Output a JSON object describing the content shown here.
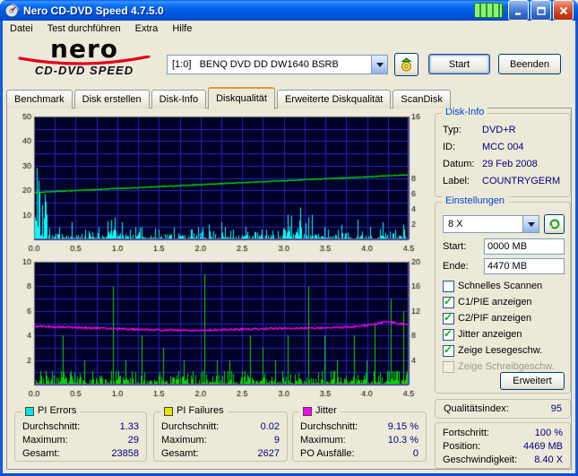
{
  "window": {
    "title": "Nero CD-DVD Speed 4.7.5.0"
  },
  "menu": {
    "items": [
      "Datei",
      "Test durchführen",
      "Extra",
      "Hilfe"
    ]
  },
  "logo": {
    "brand": "nero",
    "product": "CD-DVD SPEED"
  },
  "toolbar": {
    "drive": "[1:0]   BENQ DVD DD DW1640 BSRB",
    "start_label": "Start",
    "quit_label": "Beenden"
  },
  "tabs": {
    "active_index": 3,
    "items": [
      {
        "label": "Benchmark"
      },
      {
        "label": "Disk erstellen"
      },
      {
        "label": "Disk-Info"
      },
      {
        "label": "Diskqualität"
      },
      {
        "label": "Erweiterte Diskqualität"
      },
      {
        "label": "ScanDisk"
      }
    ]
  },
  "disk_info": {
    "title": "Disk-Info",
    "rows": [
      {
        "label": "Typ:",
        "value": "DVD+R"
      },
      {
        "label": "ID:",
        "value": "MCC 004"
      },
      {
        "label": "Datum:",
        "value": "29 Feb 2008"
      },
      {
        "label": "Label:",
        "value": "COUNTRYGERM"
      }
    ]
  },
  "settings": {
    "title": "Einstellungen",
    "speed_value": "8 X",
    "start_label": "Start:",
    "start_value": "0000 MB",
    "end_label": "Ende:",
    "end_value": "4470 MB",
    "advanced_label": "Erweitert",
    "checkboxes": [
      {
        "label": "Schnelles Scannen",
        "checked": false,
        "enabled": true
      },
      {
        "label": "C1/PIE anzeigen",
        "checked": true,
        "enabled": true
      },
      {
        "label": "C2/PIF anzeigen",
        "checked": true,
        "enabled": true
      },
      {
        "label": "Jitter anzeigen",
        "checked": true,
        "enabled": true
      },
      {
        "label": "Zeige Lesegeschw.",
        "checked": true,
        "enabled": true
      },
      {
        "label": "Zeige Schreibgeschw.",
        "checked": false,
        "enabled": false
      }
    ]
  },
  "quality": {
    "label": "Qualitätsindex:",
    "value": "95"
  },
  "progress": {
    "rows": [
      {
        "label": "Fortschritt:",
        "value": "100 %"
      },
      {
        "label": "Position:",
        "value": "4469 MB"
      },
      {
        "label": "Geschwindigkeit:",
        "value": "8.40 X"
      }
    ]
  },
  "stats": [
    {
      "title": "PI Errors",
      "color": "#00E6E6",
      "rows": [
        {
          "label": "Durchschnitt:",
          "value": "1.33"
        },
        {
          "label": "Maximum:",
          "value": "29"
        },
        {
          "label": "Gesamt:",
          "value": "23858"
        }
      ]
    },
    {
      "title": "PI Failures",
      "color": "#E6E600",
      "rows": [
        {
          "label": "Durchschnitt:",
          "value": "0.02"
        },
        {
          "label": "Maximum:",
          "value": "9"
        },
        {
          "label": "Gesamt:",
          "value": "2627"
        }
      ]
    },
    {
      "title": "Jitter",
      "color": "#FF00FF",
      "rows": [
        {
          "label": "Durchschnitt:",
          "value": "9.15 %"
        },
        {
          "label": "Maximum:",
          "value": "10.3 %"
        },
        {
          "label": "PO Ausfälle:",
          "value": "0"
        }
      ]
    }
  ],
  "icons": {
    "app-icon": "cd-speedometer",
    "power-indicator-icon": "green-battery",
    "minimize-icon": "underscore",
    "maximize-icon": "square",
    "close-icon": "x",
    "eject-disc-icon": "disc-with-up-arrow",
    "dropdown-arrow-icon": "black-triangle-down",
    "refresh-icon": "green-circular-arrow"
  },
  "chart_data": [
    {
      "type": "spikes+line",
      "x_range": [
        0,
        4.5
      ],
      "x_ticks": [
        "0.0",
        "0.5",
        "1.0",
        "1.5",
        "2.0",
        "2.5",
        "3.0",
        "3.5",
        "4.0",
        "4.5"
      ],
      "left_axis": {
        "name": "PI Errors",
        "range": [
          0,
          50
        ],
        "ticks": [
          10,
          20,
          30,
          40,
          50
        ]
      },
      "right_axis": {
        "name": "Lesegeschwindigkeit",
        "range": [
          0,
          16
        ],
        "ticks": [
          2,
          4,
          6,
          8,
          16
        ]
      },
      "bg": "#000028",
      "grid": {
        "color": "#2626B8",
        "x_step": 0.25,
        "y_step": 5
      },
      "series": [
        {
          "name": "PI Errors",
          "type": "spikes",
          "axis": "left",
          "color": "#00FFFF",
          "baseline": {
            "avg": 1.2,
            "cap": 5,
            "seed": 11
          },
          "clusters": [
            {
              "x0": 0.0,
              "x1": 0.17,
              "peak": 26
            },
            {
              "x0": 0.88,
              "x1": 1.06,
              "peak": 8
            },
            {
              "x0": 3.0,
              "x1": 3.38,
              "peak": 12
            }
          ],
          "spikes": [
            [
              0.03,
              29
            ],
            [
              0.05,
              24
            ],
            [
              0.07,
              19
            ],
            [
              0.1,
              14
            ],
            [
              0.3,
              5
            ],
            [
              0.45,
              7
            ],
            [
              0.62,
              4
            ],
            [
              0.78,
              5
            ],
            [
              0.97,
              9
            ],
            [
              1.15,
              4
            ],
            [
              1.3,
              5
            ],
            [
              1.5,
              4
            ],
            [
              1.68,
              5
            ],
            [
              1.9,
              4
            ],
            [
              2.1,
              6
            ],
            [
              2.25,
              7
            ],
            [
              2.4,
              4
            ],
            [
              2.55,
              5
            ],
            [
              2.8,
              4
            ],
            [
              3.05,
              10
            ],
            [
              3.2,
              13
            ],
            [
              3.3,
              9
            ],
            [
              3.5,
              5
            ],
            [
              3.7,
              6
            ],
            [
              3.9,
              8
            ],
            [
              4.05,
              5
            ],
            [
              4.2,
              7
            ],
            [
              4.35,
              4
            ],
            [
              4.45,
              6
            ]
          ],
          "average": 1.33,
          "maximum": 29,
          "total": 23858
        },
        {
          "name": "Lesegeschwindigkeit",
          "type": "line",
          "axis": "right",
          "color": "#00E600",
          "points": [
            [
              0,
              6.1
            ],
            [
              4.5,
              8.4
            ]
          ],
          "noise": 0.04,
          "seed": 3,
          "end_value": 8.4
        }
      ]
    },
    {
      "type": "spikes+line",
      "x_range": [
        0,
        4.5
      ],
      "x_ticks": [
        "0.0",
        "0.5",
        "1.0",
        "1.5",
        "2.0",
        "2.5",
        "3.0",
        "3.5",
        "4.0",
        "4.5"
      ],
      "left_axis": {
        "name": "PI Failures",
        "range": [
          0,
          10
        ],
        "ticks": [
          2,
          4,
          6,
          8,
          10
        ]
      },
      "right_axis": {
        "name": "Jitter %",
        "range": [
          0,
          20
        ],
        "ticks": [
          4,
          8,
          12,
          16,
          20
        ]
      },
      "bg": "#000028",
      "grid": {
        "color": "#2626B8",
        "x_step": 0.25,
        "y_step": 1
      },
      "series": [
        {
          "name": "PI Failures",
          "type": "spikes",
          "axis": "left",
          "color": "#00DC00",
          "baseline": {
            "avg": 0.4,
            "cap": 1.1,
            "seed": 23
          },
          "clusters": [],
          "spikes": [
            [
              0.35,
              4
            ],
            [
              0.6,
              2
            ],
            [
              0.95,
              8
            ],
            [
              1.1,
              2
            ],
            [
              1.3,
              4
            ],
            [
              1.55,
              3
            ],
            [
              1.8,
              2
            ],
            [
              2.05,
              9
            ],
            [
              2.2,
              2
            ],
            [
              2.35,
              2
            ],
            [
              2.6,
              4
            ],
            [
              2.75,
              3
            ],
            [
              2.9,
              2
            ],
            [
              3.05,
              4
            ],
            [
              3.3,
              8
            ],
            [
              3.5,
              4
            ],
            [
              3.65,
              2
            ],
            [
              3.85,
              4
            ],
            [
              4.0,
              2
            ],
            [
              4.1,
              5
            ],
            [
              4.3,
              7
            ],
            [
              4.45,
              6
            ]
          ],
          "average": 0.02,
          "maximum": 9,
          "total": 2627
        },
        {
          "name": "Jitter",
          "type": "line",
          "axis": "left",
          "color": "#FF00FF",
          "points": [
            [
              0,
              4.75
            ],
            [
              0.5,
              4.65
            ],
            [
              1.0,
              4.55
            ],
            [
              1.5,
              4.45
            ],
            [
              2.0,
              4.42
            ],
            [
              2.5,
              4.5
            ],
            [
              3.0,
              4.58
            ],
            [
              3.5,
              4.62
            ],
            [
              3.9,
              4.72
            ],
            [
              4.1,
              4.9
            ],
            [
              4.25,
              5.15
            ],
            [
              4.4,
              4.95
            ],
            [
              4.5,
              4.92
            ]
          ],
          "noise": 0.08,
          "seed": 5,
          "average_pct": 9.15,
          "maximum_pct": 10.3
        }
      ]
    }
  ]
}
